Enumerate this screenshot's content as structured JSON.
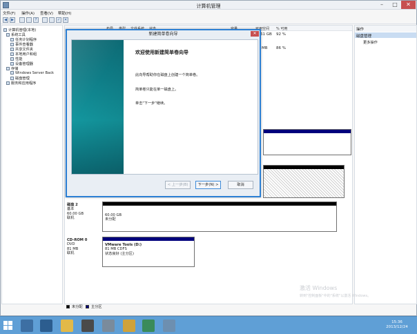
{
  "window": {
    "title": "计算机管理"
  },
  "menu": [
    "文件(F)",
    "操作(A)",
    "查看(V)",
    "帮助(H)"
  ],
  "tree": [
    {
      "label": "计算机管理(本地)",
      "level": 0,
      "toggle": "◢"
    },
    {
      "label": "系统工具",
      "level": 1,
      "toggle": "◢"
    },
    {
      "label": "任务计划程序",
      "level": 2,
      "toggle": "▷"
    },
    {
      "label": "事件查看器",
      "level": 2,
      "toggle": "▷"
    },
    {
      "label": "共享文件夹",
      "level": 2,
      "toggle": "▷"
    },
    {
      "label": "本地用户和组",
      "level": 2,
      "toggle": "▷"
    },
    {
      "label": "性能",
      "level": 2,
      "toggle": "▷"
    },
    {
      "label": "设备管理器",
      "level": 2,
      "toggle": ""
    },
    {
      "label": "存储",
      "level": 1,
      "toggle": "◢"
    },
    {
      "label": "Windows Server Back",
      "level": 2,
      "toggle": "▷"
    },
    {
      "label": "磁盘管理",
      "level": 2,
      "toggle": ""
    },
    {
      "label": "服务和应用程序",
      "level": 1,
      "toggle": "▷"
    }
  ],
  "volume_table": {
    "headers": [
      "布局",
      "类型",
      "文件系统",
      "状态",
      "容量",
      "可用空间",
      "% 可用"
    ],
    "rows": [
      [
        "61 GB",
        "92 %"
      ],
      [
        "MB",
        "86 %"
      ]
    ]
  },
  "disks": {
    "disk2": {
      "name": "磁盘 2",
      "type": "基本",
      "size": "60.00 GB",
      "status": "联机",
      "part_size": "60.00 GB",
      "part_status": "未分配"
    },
    "cdrom": {
      "name": "CD-ROM 0",
      "type": "DVD",
      "size": "81 MB",
      "status": "联机",
      "vol_name": "VMware Tools  (D:)",
      "vol_fs": "81 MB CDFS",
      "vol_status": "状态良好 (主分区)"
    }
  },
  "legend": {
    "unallocated": "未分配",
    "primary": "主分区"
  },
  "actions": {
    "header": "操作",
    "selected": "磁盘管理",
    "more": "更多操作"
  },
  "watermark": {
    "line1": "激活 Windows",
    "line2": "转到\"控制面板\"中的\"系统\"以激活 Windows。"
  },
  "clock": {
    "time": "15:36",
    "date": "2013/12/24"
  },
  "dialog": {
    "title": "新建简单卷向导",
    "heading": "欢迎使用新建简单卷向导",
    "line1": "此向导帮助你在磁盘上创建一个简单卷。",
    "line2": "简单卷只能在单一磁盘上。",
    "line3": "单击\"下一步\"继续。",
    "back": "< 上一步(B)",
    "next": "下一步(N) >",
    "cancel": "取消"
  },
  "colors": {
    "accent": "#2b7fd4",
    "partition_bar": "#00007c",
    "unallocated_bar": "#000000",
    "taskbar": "#5f9fd6"
  }
}
